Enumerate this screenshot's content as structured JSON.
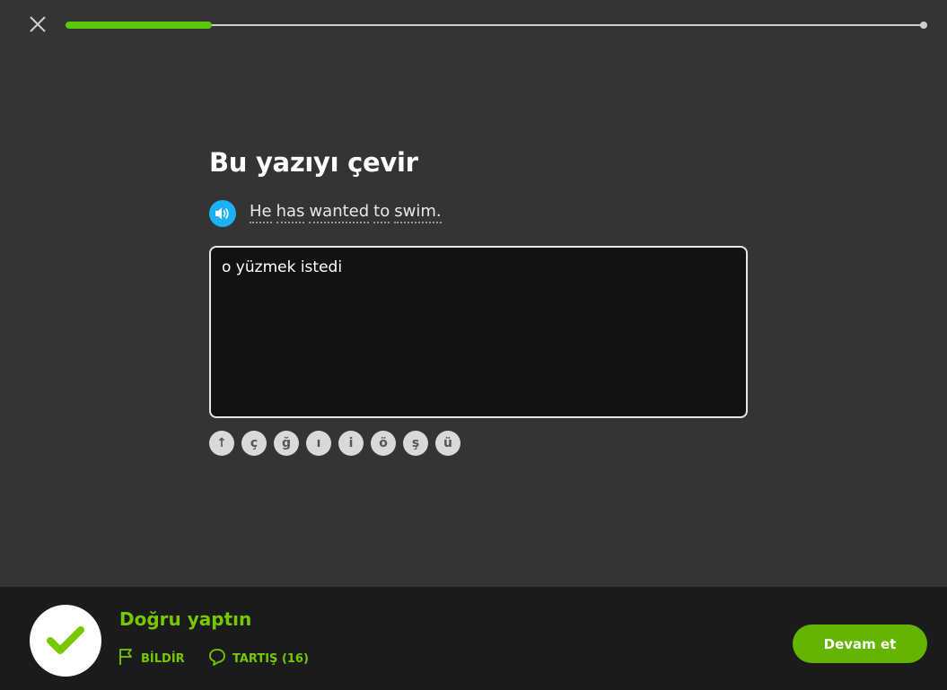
{
  "header": {
    "close_icon": "close-icon",
    "progress": 0.17
  },
  "exercise": {
    "title": "Bu yazıyı çevir",
    "speaker_icon": "speaker-icon",
    "prompt_words": [
      "He",
      "has",
      "wanted",
      "to",
      "swim."
    ],
    "answer_value": "o yüzmek istedi",
    "special_keys": [
      "↑",
      "ç",
      "ğ",
      "ı",
      "i",
      "ö",
      "ş",
      "ü"
    ]
  },
  "footer": {
    "result_title": "Doğru yaptın",
    "report_label": "BİLDİR",
    "discuss_label": "TARTIŞ (16)",
    "continue_label": "Devam et",
    "check_icon": "check-icon",
    "flag_icon": "flag-icon",
    "comment_icon": "comment-icon"
  },
  "colors": {
    "accent_green": "#58c80a",
    "result_green": "#78c800",
    "button_green": "#64b400",
    "speaker_blue": "#1cb0f6"
  }
}
